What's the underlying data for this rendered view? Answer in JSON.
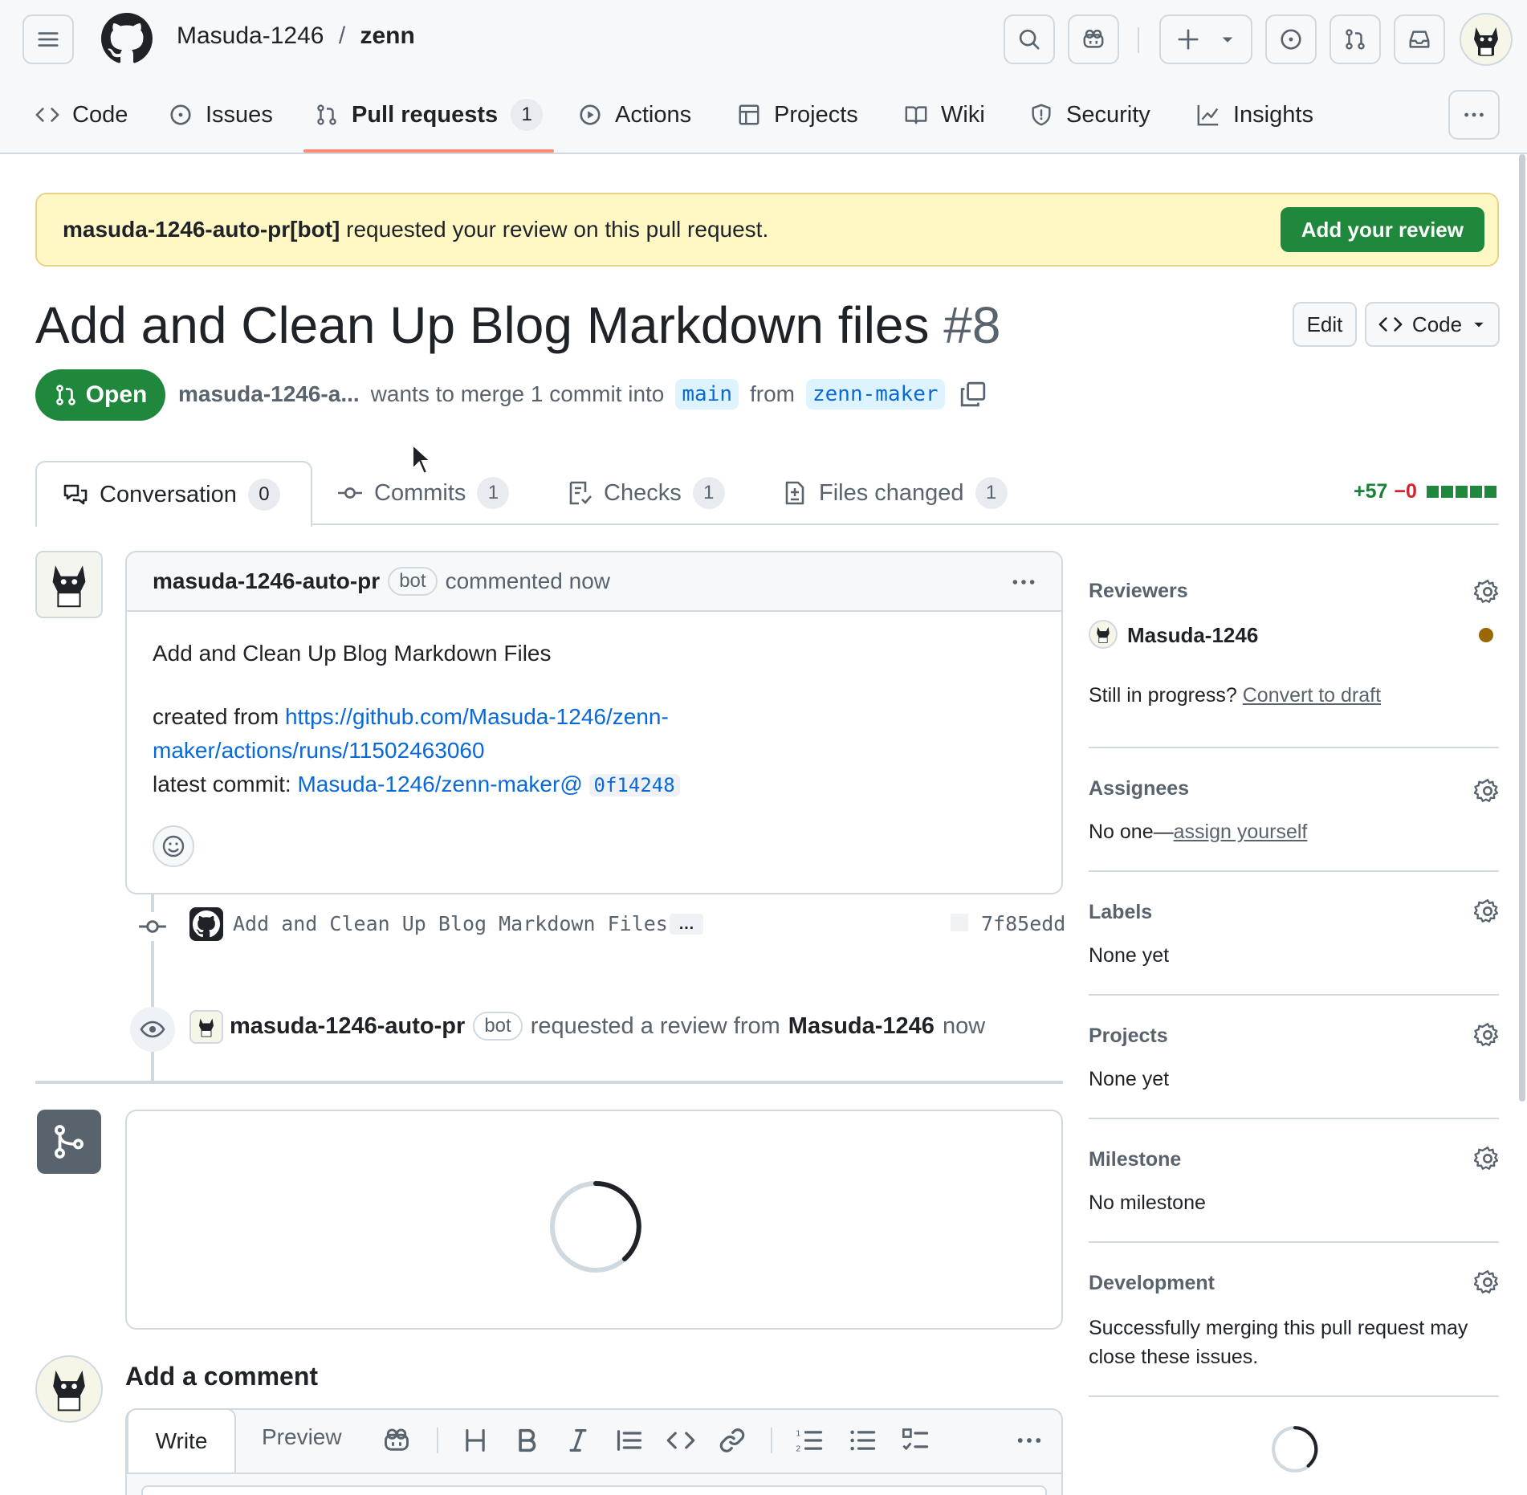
{
  "header": {
    "owner": "Masuda-1246",
    "separator": "/",
    "repo": "zenn"
  },
  "nav": {
    "code": "Code",
    "issues": "Issues",
    "pull_requests": "Pull requests",
    "pull_requests_count": "1",
    "actions": "Actions",
    "projects": "Projects",
    "wiki": "Wiki",
    "security": "Security",
    "insights": "Insights"
  },
  "banner": {
    "bot": "masuda-1246-auto-pr[bot]",
    "text": " requested your review on this pull request.",
    "button": "Add your review"
  },
  "pr": {
    "title": "Add and Clean Up Blog Markdown files",
    "number": "#8",
    "edit": "Edit",
    "code": "Code",
    "state": "Open",
    "author": "masuda-1246-a...",
    "merge_text": "wants to merge 1 commit into",
    "base": "main",
    "from": "from",
    "head": "zenn-maker"
  },
  "tabs": {
    "conversation": "Conversation",
    "conversation_count": "0",
    "commits": "Commits",
    "commits_count": "1",
    "checks": "Checks",
    "checks_count": "1",
    "files": "Files changed",
    "files_count": "1",
    "additions": "+57",
    "deletions": "−0"
  },
  "comment": {
    "author": "masuda-1246-auto-pr",
    "bot": "bot",
    "time": "commented now",
    "heading": "Add and Clean Up Blog Markdown Files",
    "created_from": "created from ",
    "link1": "https://github.com/Masuda-1246/zenn-",
    "link2": "maker/actions/runs/11502463060",
    "latest_commit": "latest commit: ",
    "commit_link": "Masuda-1246/zenn-maker@",
    "commit_sha": "0f14248"
  },
  "timeline": {
    "commit_message": "Add and Clean Up Blog Markdown Files",
    "ellipsis": "…",
    "commit_sha": "7f85edd",
    "review_actor": "masuda-1246-auto-pr",
    "review_bot": "bot",
    "review_text": "requested a review from",
    "review_target": "Masuda-1246",
    "review_time": "now"
  },
  "add_comment": {
    "heading": "Add a comment",
    "write": "Write",
    "preview": "Preview"
  },
  "sidebar": {
    "reviewers": "Reviewers",
    "reviewer_name": "Masuda-1246",
    "still": "Still in progress? ",
    "convert": "Convert to draft",
    "assignees": "Assignees",
    "no_one": "No one—",
    "assign_yourself": "assign yourself",
    "labels": "Labels",
    "labels_value": "None yet",
    "projects": "Projects",
    "projects_value": "None yet",
    "milestone": "Milestone",
    "milestone_value": "No milestone",
    "development": "Development",
    "development_text1": "Successfully merging this pull request may",
    "development_text2": "close these issues."
  },
  "colors": {
    "accent_green": "#1f883d",
    "link_blue": "#0969da",
    "banner_yellow": "#fff8c5",
    "nav_underline": "#fd8c73",
    "pending_dot": "#9a6700"
  }
}
